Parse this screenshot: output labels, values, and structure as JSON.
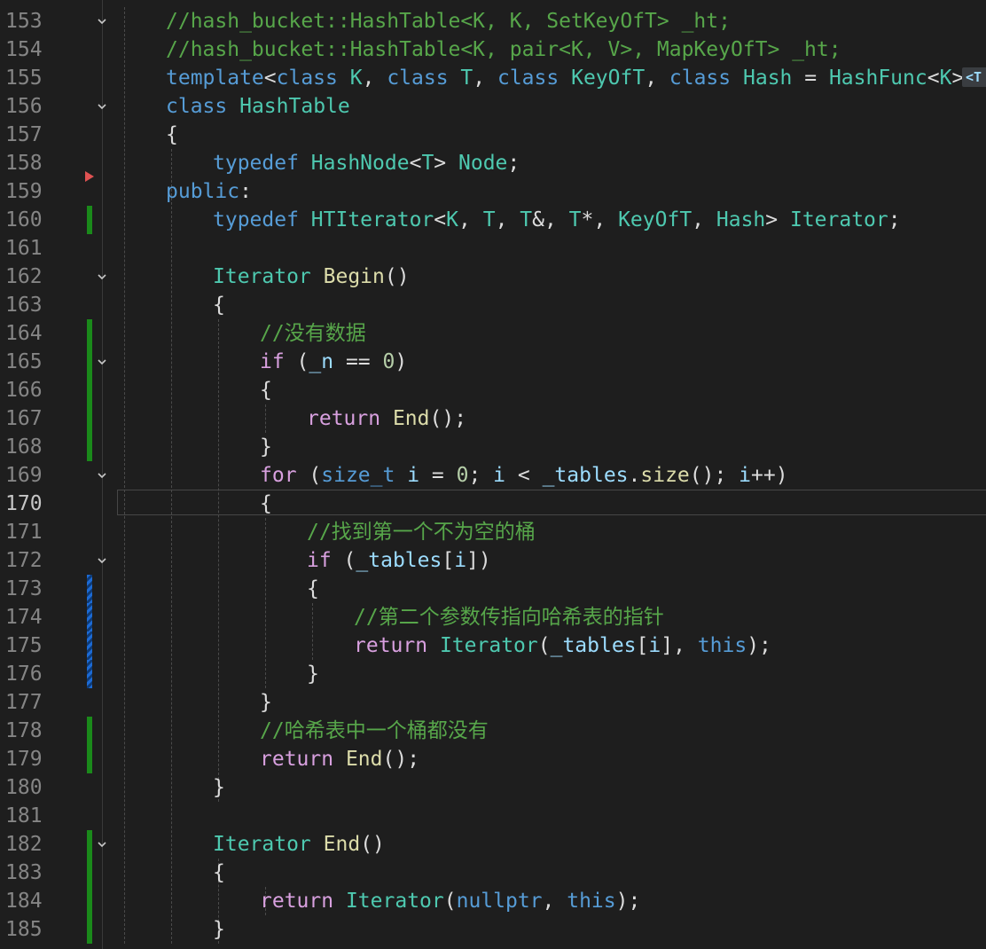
{
  "editor": {
    "language": "C++",
    "current_line": 170,
    "inline_hint_label": "<T",
    "colors": {
      "background": "#1e1e1e",
      "keyword": "#569cd6",
      "type": "#4ec9b0",
      "function": "#dcdcaa",
      "comment": "#57a64a",
      "number": "#b5cea8",
      "control": "#d8a0df",
      "variable": "#9cdcfe",
      "change_saved": "#1a8a1a",
      "change_unsaved": "#1c6ad4"
    },
    "lines": [
      {
        "n": "153",
        "fold": true,
        "change": "",
        "indent": 0,
        "tokens": [
          {
            "t": "//hash_bucket::HashTable<K, K, SetKeyOfT> _ht;",
            "c": "cm"
          }
        ]
      },
      {
        "n": "154",
        "fold": false,
        "change": "",
        "indent": 0,
        "tokens": [
          {
            "t": "//hash_bucket::HashTable<K, pair<K, V>, MapKeyOfT> _ht;",
            "c": "cm"
          }
        ]
      },
      {
        "n": "155",
        "fold": false,
        "change": "",
        "indent": 0,
        "tokens": [
          {
            "t": "template",
            "c": "kw"
          },
          {
            "t": "<",
            "c": "pl"
          },
          {
            "t": "class",
            "c": "kw"
          },
          {
            "t": " ",
            "c": "pl"
          },
          {
            "t": "K",
            "c": "ty"
          },
          {
            "t": ", ",
            "c": "pl"
          },
          {
            "t": "class",
            "c": "kw"
          },
          {
            "t": " ",
            "c": "pl"
          },
          {
            "t": "T",
            "c": "ty"
          },
          {
            "t": ", ",
            "c": "pl"
          },
          {
            "t": "class",
            "c": "kw"
          },
          {
            "t": " ",
            "c": "pl"
          },
          {
            "t": "KeyOfT",
            "c": "ty"
          },
          {
            "t": ", ",
            "c": "pl"
          },
          {
            "t": "class",
            "c": "kw"
          },
          {
            "t": " ",
            "c": "pl"
          },
          {
            "t": "Hash",
            "c": "ty"
          },
          {
            "t": " = ",
            "c": "pl"
          },
          {
            "t": "HashFunc",
            "c": "ty"
          },
          {
            "t": "<",
            "c": "pl"
          },
          {
            "t": "K",
            "c": "ty"
          },
          {
            "t": ">>",
            "c": "pl"
          }
        ]
      },
      {
        "n": "156",
        "fold": true,
        "change": "",
        "indent": 0,
        "tokens": [
          {
            "t": "class",
            "c": "kw"
          },
          {
            "t": " ",
            "c": "pl"
          },
          {
            "t": "HashTable",
            "c": "ty"
          }
        ]
      },
      {
        "n": "157",
        "fold": false,
        "change": "",
        "indent": 0,
        "tokens": [
          {
            "t": "{",
            "c": "pl"
          }
        ]
      },
      {
        "n": "158",
        "fold": false,
        "change": "",
        "indent": 1,
        "tokens": [
          {
            "t": "typedef",
            "c": "kw"
          },
          {
            "t": " ",
            "c": "pl"
          },
          {
            "t": "HashNode",
            "c": "ty"
          },
          {
            "t": "<",
            "c": "pl"
          },
          {
            "t": "T",
            "c": "ty"
          },
          {
            "t": "> ",
            "c": "pl"
          },
          {
            "t": "Node",
            "c": "ty"
          },
          {
            "t": ";",
            "c": "pl"
          }
        ]
      },
      {
        "n": "159",
        "fold": false,
        "change": "",
        "indent": 0,
        "tokens": [
          {
            "t": "public",
            "c": "kw"
          },
          {
            "t": ":",
            "c": "pl"
          }
        ]
      },
      {
        "n": "160",
        "fold": false,
        "change": "saved",
        "indent": 1,
        "tokens": [
          {
            "t": "typedef",
            "c": "kw"
          },
          {
            "t": " ",
            "c": "pl"
          },
          {
            "t": "HTIterator",
            "c": "ty"
          },
          {
            "t": "<",
            "c": "pl"
          },
          {
            "t": "K",
            "c": "ty"
          },
          {
            "t": ", ",
            "c": "pl"
          },
          {
            "t": "T",
            "c": "ty"
          },
          {
            "t": ", ",
            "c": "pl"
          },
          {
            "t": "T",
            "c": "ty"
          },
          {
            "t": "&, ",
            "c": "pl"
          },
          {
            "t": "T",
            "c": "ty"
          },
          {
            "t": "*, ",
            "c": "pl"
          },
          {
            "t": "KeyOfT",
            "c": "ty"
          },
          {
            "t": ", ",
            "c": "pl"
          },
          {
            "t": "Hash",
            "c": "ty"
          },
          {
            "t": "> ",
            "c": "pl"
          },
          {
            "t": "Iterator",
            "c": "ty"
          },
          {
            "t": ";",
            "c": "pl"
          }
        ]
      },
      {
        "n": "161",
        "fold": false,
        "change": "",
        "indent": 1,
        "tokens": []
      },
      {
        "n": "162",
        "fold": true,
        "change": "",
        "indent": 1,
        "tokens": [
          {
            "t": "Iterator",
            "c": "ty"
          },
          {
            "t": " ",
            "c": "pl"
          },
          {
            "t": "Begin",
            "c": "fn"
          },
          {
            "t": "()",
            "c": "pl"
          }
        ]
      },
      {
        "n": "163",
        "fold": false,
        "change": "",
        "indent": 1,
        "tokens": [
          {
            "t": "{",
            "c": "pl"
          }
        ]
      },
      {
        "n": "164",
        "fold": false,
        "change": "saved",
        "indent": 2,
        "tokens": [
          {
            "t": "//没有数据",
            "c": "cm"
          }
        ]
      },
      {
        "n": "165",
        "fold": true,
        "change": "saved",
        "indent": 2,
        "tokens": [
          {
            "t": "if",
            "c": "ctl"
          },
          {
            "t": " (",
            "c": "pl"
          },
          {
            "t": "_n",
            "c": "vr"
          },
          {
            "t": " == ",
            "c": "pl"
          },
          {
            "t": "0",
            "c": "num"
          },
          {
            "t": ")",
            "c": "pl"
          }
        ]
      },
      {
        "n": "166",
        "fold": false,
        "change": "saved",
        "indent": 2,
        "tokens": [
          {
            "t": "{",
            "c": "pl"
          }
        ]
      },
      {
        "n": "167",
        "fold": false,
        "change": "saved",
        "indent": 3,
        "tokens": [
          {
            "t": "return",
            "c": "ctl"
          },
          {
            "t": " ",
            "c": "pl"
          },
          {
            "t": "End",
            "c": "fn"
          },
          {
            "t": "();",
            "c": "pl"
          }
        ]
      },
      {
        "n": "168",
        "fold": false,
        "change": "saved",
        "indent": 2,
        "tokens": [
          {
            "t": "}",
            "c": "pl"
          }
        ]
      },
      {
        "n": "169",
        "fold": true,
        "change": "",
        "indent": 2,
        "tokens": [
          {
            "t": "for",
            "c": "ctl"
          },
          {
            "t": " (",
            "c": "pl"
          },
          {
            "t": "size_t",
            "c": "kw"
          },
          {
            "t": " ",
            "c": "pl"
          },
          {
            "t": "i",
            "c": "vr"
          },
          {
            "t": " = ",
            "c": "pl"
          },
          {
            "t": "0",
            "c": "num"
          },
          {
            "t": "; ",
            "c": "pl"
          },
          {
            "t": "i",
            "c": "vr"
          },
          {
            "t": " < ",
            "c": "pl"
          },
          {
            "t": "_tables",
            "c": "vr"
          },
          {
            "t": ".",
            "c": "pl"
          },
          {
            "t": "size",
            "c": "fn"
          },
          {
            "t": "(); ",
            "c": "pl"
          },
          {
            "t": "i",
            "c": "vr"
          },
          {
            "t": "++)",
            "c": "pl"
          }
        ]
      },
      {
        "n": "170",
        "fold": false,
        "change": "",
        "indent": 2,
        "tokens": [
          {
            "t": "{",
            "c": "pl"
          }
        ]
      },
      {
        "n": "171",
        "fold": false,
        "change": "",
        "indent": 3,
        "tokens": [
          {
            "t": "//找到第一个不为空的桶",
            "c": "cm"
          }
        ]
      },
      {
        "n": "172",
        "fold": true,
        "change": "",
        "indent": 3,
        "tokens": [
          {
            "t": "if",
            "c": "ctl"
          },
          {
            "t": " (",
            "c": "pl"
          },
          {
            "t": "_tables",
            "c": "vr"
          },
          {
            "t": "[",
            "c": "pl"
          },
          {
            "t": "i",
            "c": "vr"
          },
          {
            "t": "])",
            "c": "pl"
          }
        ]
      },
      {
        "n": "173",
        "fold": false,
        "change": "unsaved",
        "indent": 3,
        "tokens": [
          {
            "t": "{",
            "c": "pl"
          }
        ]
      },
      {
        "n": "174",
        "fold": false,
        "change": "unsaved",
        "indent": 4,
        "tokens": [
          {
            "t": "//第二个参数传指向哈希表的指针",
            "c": "cm"
          }
        ]
      },
      {
        "n": "175",
        "fold": false,
        "change": "unsaved",
        "indent": 4,
        "tokens": [
          {
            "t": "return",
            "c": "ctl"
          },
          {
            "t": " ",
            "c": "pl"
          },
          {
            "t": "Iterator",
            "c": "ty"
          },
          {
            "t": "(",
            "c": "pl"
          },
          {
            "t": "_tables",
            "c": "vr"
          },
          {
            "t": "[",
            "c": "pl"
          },
          {
            "t": "i",
            "c": "vr"
          },
          {
            "t": "], ",
            "c": "pl"
          },
          {
            "t": "this",
            "c": "kw"
          },
          {
            "t": ");",
            "c": "pl"
          }
        ]
      },
      {
        "n": "176",
        "fold": false,
        "change": "unsaved",
        "indent": 3,
        "tokens": [
          {
            "t": "}",
            "c": "pl"
          }
        ]
      },
      {
        "n": "177",
        "fold": false,
        "change": "",
        "indent": 2,
        "tokens": [
          {
            "t": "}",
            "c": "pl"
          }
        ]
      },
      {
        "n": "178",
        "fold": false,
        "change": "saved",
        "indent": 2,
        "tokens": [
          {
            "t": "//哈希表中一个桶都没有",
            "c": "cm"
          }
        ]
      },
      {
        "n": "179",
        "fold": false,
        "change": "saved",
        "indent": 2,
        "tokens": [
          {
            "t": "return",
            "c": "ctl"
          },
          {
            "t": " ",
            "c": "pl"
          },
          {
            "t": "End",
            "c": "fn"
          },
          {
            "t": "();",
            "c": "pl"
          }
        ]
      },
      {
        "n": "180",
        "fold": false,
        "change": "",
        "indent": 1,
        "tokens": [
          {
            "t": "}",
            "c": "pl"
          }
        ]
      },
      {
        "n": "181",
        "fold": false,
        "change": "",
        "indent": 1,
        "tokens": []
      },
      {
        "n": "182",
        "fold": true,
        "change": "saved",
        "indent": 1,
        "tokens": [
          {
            "t": "Iterator",
            "c": "ty"
          },
          {
            "t": " ",
            "c": "pl"
          },
          {
            "t": "End",
            "c": "fn"
          },
          {
            "t": "()",
            "c": "pl"
          }
        ]
      },
      {
        "n": "183",
        "fold": false,
        "change": "saved",
        "indent": 1,
        "tokens": [
          {
            "t": "{",
            "c": "pl"
          }
        ]
      },
      {
        "n": "184",
        "fold": false,
        "change": "saved",
        "indent": 2,
        "tokens": [
          {
            "t": "return",
            "c": "ctl"
          },
          {
            "t": " ",
            "c": "pl"
          },
          {
            "t": "Iterator",
            "c": "ty"
          },
          {
            "t": "(",
            "c": "pl"
          },
          {
            "t": "nullptr",
            "c": "kw"
          },
          {
            "t": ", ",
            "c": "pl"
          },
          {
            "t": "this",
            "c": "kw"
          },
          {
            "t": ");",
            "c": "pl"
          }
        ]
      },
      {
        "n": "185",
        "fold": false,
        "change": "saved",
        "indent": 1,
        "tokens": [
          {
            "t": "}",
            "c": "pl"
          }
        ]
      }
    ]
  }
}
